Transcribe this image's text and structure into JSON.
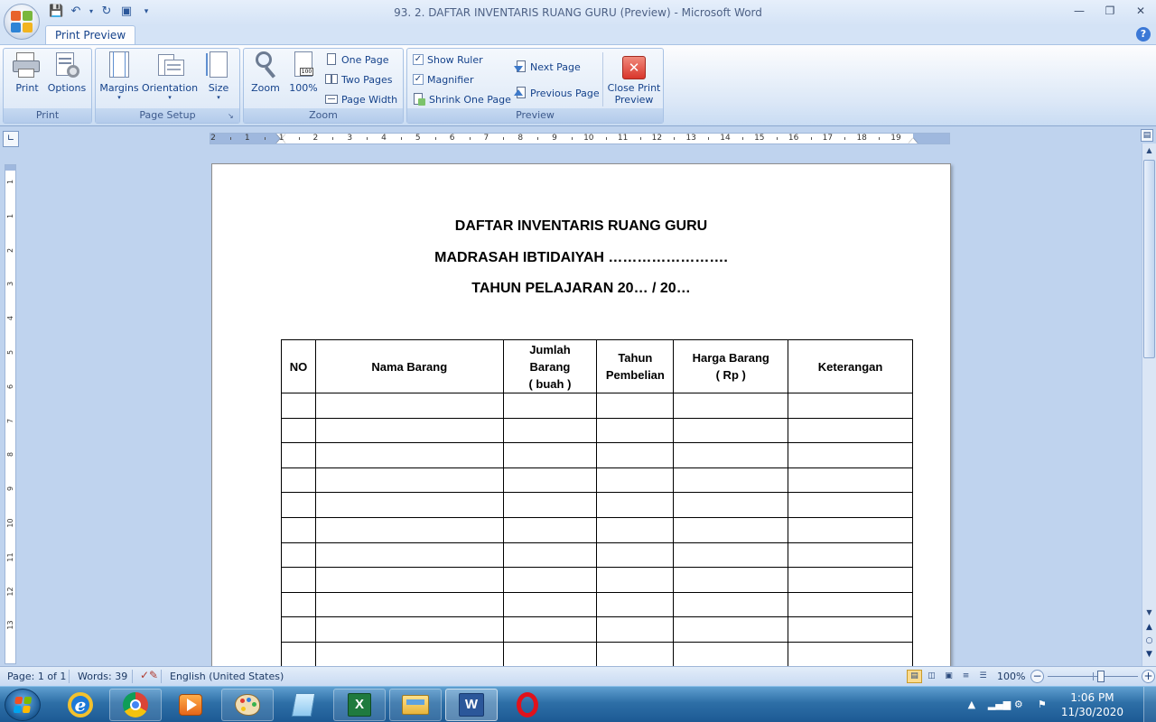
{
  "window": {
    "title": "93. 2. DAFTAR INVENTARIS RUANG GURU (Preview) - Microsoft Word"
  },
  "ribbon": {
    "active_tab": "Print Preview",
    "groups": {
      "print": {
        "label": "Print",
        "print_label": "Print",
        "options_label": "Options"
      },
      "page_setup": {
        "label": "Page Setup",
        "margins_label": "Margins",
        "orientation_label": "Orientation",
        "size_label": "Size"
      },
      "zoom": {
        "label": "Zoom",
        "zoom_label": "Zoom",
        "hundred_label": "100%",
        "one_page_label": "One Page",
        "two_pages_label": "Two Pages",
        "page_width_label": "Page Width"
      },
      "preview": {
        "label": "Preview",
        "show_ruler_label": "Show Ruler",
        "show_ruler_checked": true,
        "magnifier_label": "Magnifier",
        "magnifier_checked": true,
        "shrink_label": "Shrink One Page",
        "next_page_label": "Next Page",
        "previous_page_label": "Previous Page",
        "close_label_1": "Close Print",
        "close_label_2": "Preview"
      }
    }
  },
  "ruler": {
    "h_numbers": [
      "2",
      "1",
      "1",
      "2",
      "3",
      "4",
      "5",
      "6",
      "7",
      "8",
      "9",
      "10",
      "11",
      "12",
      "13",
      "14",
      "15",
      "16",
      "17",
      "18",
      "19"
    ],
    "v_numbers": [
      "1",
      "1",
      "2",
      "3",
      "4",
      "5",
      "6",
      "7",
      "8",
      "9",
      "10",
      "11",
      "12",
      "13"
    ]
  },
  "document": {
    "title_line1": "DAFTAR INVENTARIS RUANG GURU",
    "title_line2": "MADRASAH IBTIDAIYAH …………………….",
    "title_line3": "TAHUN PELAJARAN 20… / 20…",
    "table": {
      "headers": [
        "NO",
        "Nama Barang",
        "Jumlah Barang ( buah )",
        "Tahun Pembelian",
        "Harga Barang ( Rp )",
        "Keterangan"
      ],
      "header_lines": {
        "col3": [
          "Jumlah",
          "Barang",
          "( buah )"
        ],
        "col4": [
          "Tahun",
          "Pembelian"
        ],
        "col5": [
          "Harga Barang",
          "( Rp )"
        ]
      },
      "empty_rows": 11
    }
  },
  "statusbar": {
    "page": "Page: 1 of 1",
    "words": "Words: 39",
    "language": "English (United States)",
    "zoom": "100%"
  },
  "taskbar": {
    "time": "1:06 PM",
    "date": "11/30/2020"
  },
  "colors": {
    "ribbon_text": "#15428b",
    "accent": "#2b579a",
    "close_red": "#d9362b"
  }
}
